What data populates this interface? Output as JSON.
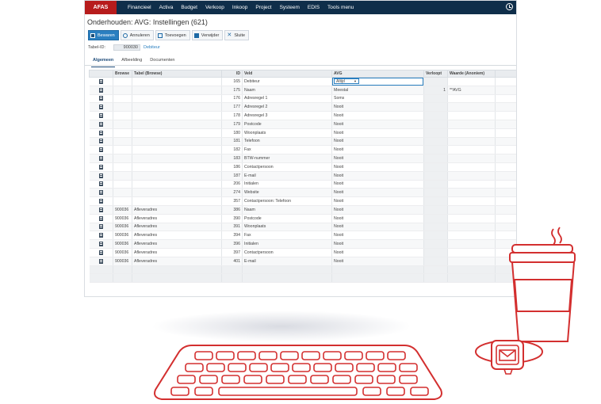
{
  "menubar": {
    "logo_text": "AFAS",
    "items": [
      "Financieel",
      "Activa",
      "Budget",
      "Verkoop",
      "Inkoop",
      "Project",
      "Systeem",
      "EDIS",
      "Tools menu"
    ]
  },
  "page_title": "Onderhouden: AVG: Instellingen (621)",
  "toolbar": {
    "save": "Bewaren",
    "cancel": "Annuleren",
    "add": "Toevoegen",
    "delete": "Verwijder",
    "close": "Sluite"
  },
  "tabelid": {
    "label": "Tabel-ID:",
    "value": "900030",
    "link": "Debiteur"
  },
  "tabs": [
    "Algemeen",
    "Afbeelding",
    "Documenten"
  ],
  "grid": {
    "headers": [
      "",
      "Browse",
      "Tabel (Browse)",
      "ID",
      "Veld",
      "AVG",
      "Verloopt",
      "Waarde (Anoniem)",
      ""
    ],
    "rows": [
      {
        "browse": "",
        "tabel": "",
        "id": "165",
        "veld": "Debiteur",
        "avg": "Altijd",
        "verloopt": "",
        "waarde": ""
      },
      {
        "browse": "",
        "tabel": "",
        "id": "175",
        "veld": "Naam",
        "avg": "Meestal",
        "verloopt": "1",
        "waarde": "**AVG"
      },
      {
        "browse": "",
        "tabel": "",
        "id": "176",
        "veld": "Adresregel 1",
        "avg": "Soms",
        "verloopt": "",
        "waarde": ""
      },
      {
        "browse": "",
        "tabel": "",
        "id": "177",
        "veld": "Adresregel 2",
        "avg": "Nooit",
        "verloopt": "",
        "waarde": ""
      },
      {
        "browse": "",
        "tabel": "",
        "id": "178",
        "veld": "Adresregel 3",
        "avg": "Nooit",
        "verloopt": "",
        "waarde": ""
      },
      {
        "browse": "",
        "tabel": "",
        "id": "179",
        "veld": "Postcode",
        "avg": "Nooit",
        "verloopt": "",
        "waarde": ""
      },
      {
        "browse": "",
        "tabel": "",
        "id": "180",
        "veld": "Woonplaats",
        "avg": "Nooit",
        "verloopt": "",
        "waarde": ""
      },
      {
        "browse": "",
        "tabel": "",
        "id": "181",
        "veld": "Telefoon",
        "avg": "Nooit",
        "verloopt": "",
        "waarde": ""
      },
      {
        "browse": "",
        "tabel": "",
        "id": "182",
        "veld": "Fax",
        "avg": "Nooit",
        "verloopt": "",
        "waarde": ""
      },
      {
        "browse": "",
        "tabel": "",
        "id": "183",
        "veld": "BTW-nummer",
        "avg": "Nooit",
        "verloopt": "",
        "waarde": ""
      },
      {
        "browse": "",
        "tabel": "",
        "id": "186",
        "veld": "Contactpersoon",
        "avg": "Nooit",
        "verloopt": "",
        "waarde": ""
      },
      {
        "browse": "",
        "tabel": "",
        "id": "187",
        "veld": "E-mail",
        "avg": "Nooit",
        "verloopt": "",
        "waarde": ""
      },
      {
        "browse": "",
        "tabel": "",
        "id": "206",
        "veld": "Initialen",
        "avg": "Nooit",
        "verloopt": "",
        "waarde": ""
      },
      {
        "browse": "",
        "tabel": "",
        "id": "274",
        "veld": "Website",
        "avg": "Nooit",
        "verloopt": "",
        "waarde": ""
      },
      {
        "browse": "",
        "tabel": "",
        "id": "357",
        "veld": "Contactpersoon: Telefoon",
        "avg": "Nooit",
        "verloopt": "",
        "waarde": ""
      },
      {
        "browse": "900036",
        "tabel": "Afleveradres",
        "id": "386",
        "veld": "Naam",
        "avg": "Nooit",
        "verloopt": "",
        "waarde": ""
      },
      {
        "browse": "900036",
        "tabel": "Afleveradres",
        "id": "390",
        "veld": "Postcode",
        "avg": "Nooit",
        "verloopt": "",
        "waarde": ""
      },
      {
        "browse": "900036",
        "tabel": "Afleveradres",
        "id": "391",
        "veld": "Woonplaats",
        "avg": "Nooit",
        "verloopt": "",
        "waarde": ""
      },
      {
        "browse": "900036",
        "tabel": "Afleveradres",
        "id": "394",
        "veld": "Fax",
        "avg": "Nooit",
        "verloopt": "",
        "waarde": ""
      },
      {
        "browse": "900036",
        "tabel": "Afleveradres",
        "id": "396",
        "veld": "Initialen",
        "avg": "Nooit",
        "verloopt": "",
        "waarde": ""
      },
      {
        "browse": "900036",
        "tabel": "Afleveradres",
        "id": "397",
        "veld": "Contactpersoon",
        "avg": "Nooit",
        "verloopt": "",
        "waarde": ""
      },
      {
        "browse": "900036",
        "tabel": "Afleveradres",
        "id": "401",
        "veld": "E-mail",
        "avg": "Nooit",
        "verloopt": "",
        "waarde": ""
      }
    ]
  },
  "colors": {
    "brand_red": "#b71c1c",
    "menubar": "#0f2e4a",
    "accent": "#2a7fc0",
    "illustration_red": "#d32f2f"
  }
}
